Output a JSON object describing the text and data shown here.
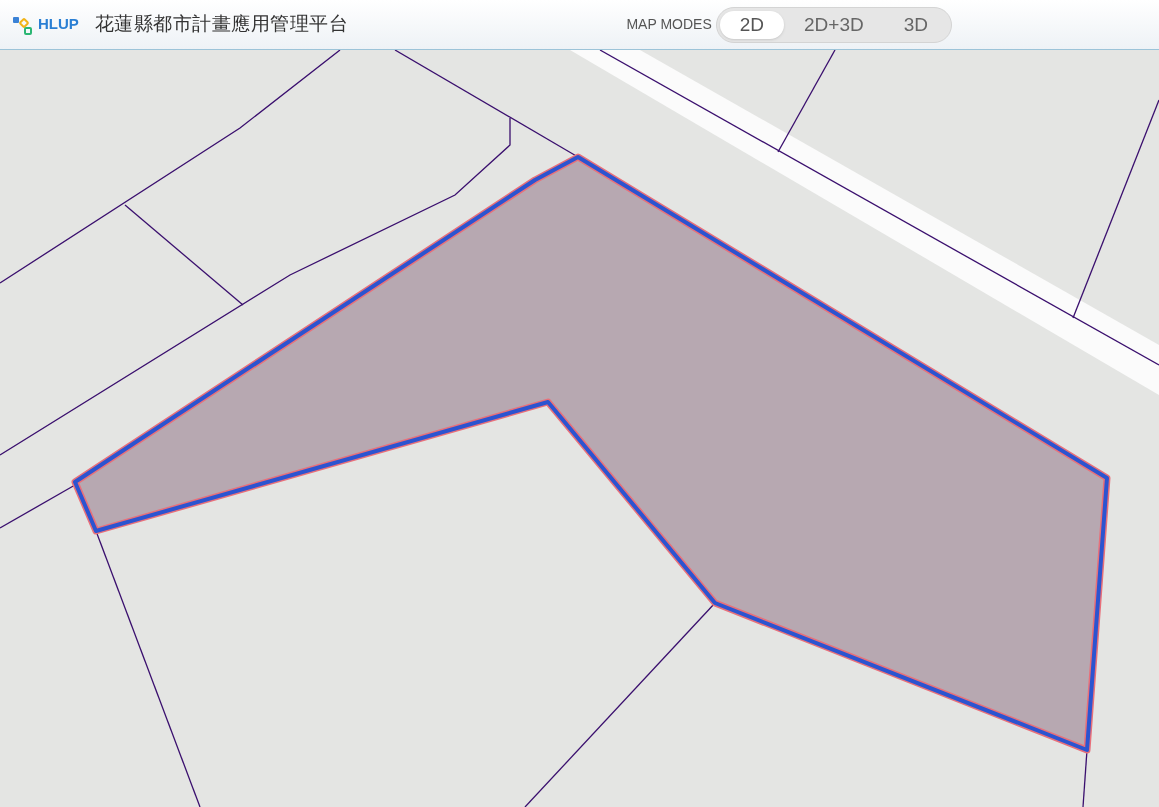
{
  "header": {
    "logo_text": "HLUP",
    "title": "花蓮縣都市計畫應用管理平台"
  },
  "map_modes": {
    "label": "MAP MODES",
    "modes": [
      {
        "label": "2D",
        "selected": true
      },
      {
        "label": "2D+3D",
        "selected": false
      },
      {
        "label": "3D",
        "selected": false
      }
    ]
  }
}
